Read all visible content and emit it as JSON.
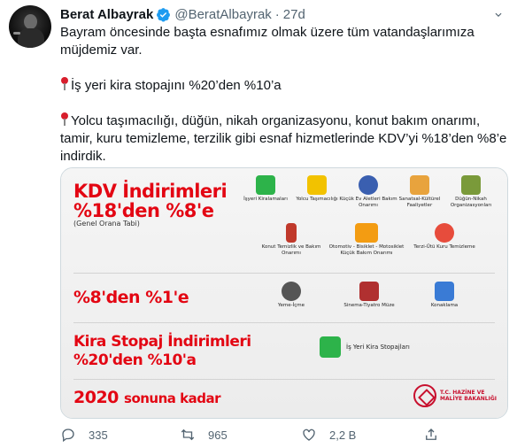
{
  "author": {
    "name": "Berat Albayrak",
    "handle": "@BeratAlbayrak",
    "time": "27d"
  },
  "tweet_text": {
    "line1": "Bayram öncesinde başta esnafımız olmak üzere tüm vatandaşlarımıza müjdemiz var.",
    "line2": "İş yeri kira stopajını %20’den %10’a",
    "line3": "Yolcu taşımacılığı, düğün, nikah organizasyonu, konut bakım onarımı, tamir, kuru temizleme, terzilik gibi esnaf hizmetlerinde KDV’yi %18’den %8’e indirdik."
  },
  "infographic": {
    "kdv_title": "KDV İndirimleri",
    "kdv_rate": "%18'den %8'e",
    "kdv_note": "(Genel Orana Tabi)",
    "second_rate": "%8'den %1'e",
    "stopaj_title": "Kira Stopaj İndirimleri",
    "stopaj_rate": "%20'den %10'a",
    "deadline_a": "2020",
    "deadline_b": "sonuna kadar",
    "items_row1": [
      "İşyeri Kiralamaları",
      "Yolcu Taşımacılığı",
      "Küçük Ev Aletleri Bakım Onarımı",
      "Sanatsal-Kültürel Faaliyetler",
      "Düğün-Nikah Organizasyonları"
    ],
    "items_row2": [
      "Konut Temizlik ve Bakım Onarımı",
      "Otomotiv - Bisiklet - Motosiklet Küçük Bakım Onarımı",
      "Terzi-Ütü Kuru Temizleme"
    ],
    "items_row3": [
      "Yeme-İçme",
      "Sinema-Tiyatro Müze",
      "Konaklama"
    ],
    "stopaj_item": "İş Yeri Kira Stopajları",
    "ministry_line1": "T.C. HAZİNE VE",
    "ministry_line2": "MALİYE BAKANLIĞI"
  },
  "actions": {
    "replies": "335",
    "retweets": "965",
    "likes": "2,2 B"
  },
  "colors": {
    "accent_red": "#e30613",
    "text_gray": "#536471"
  }
}
